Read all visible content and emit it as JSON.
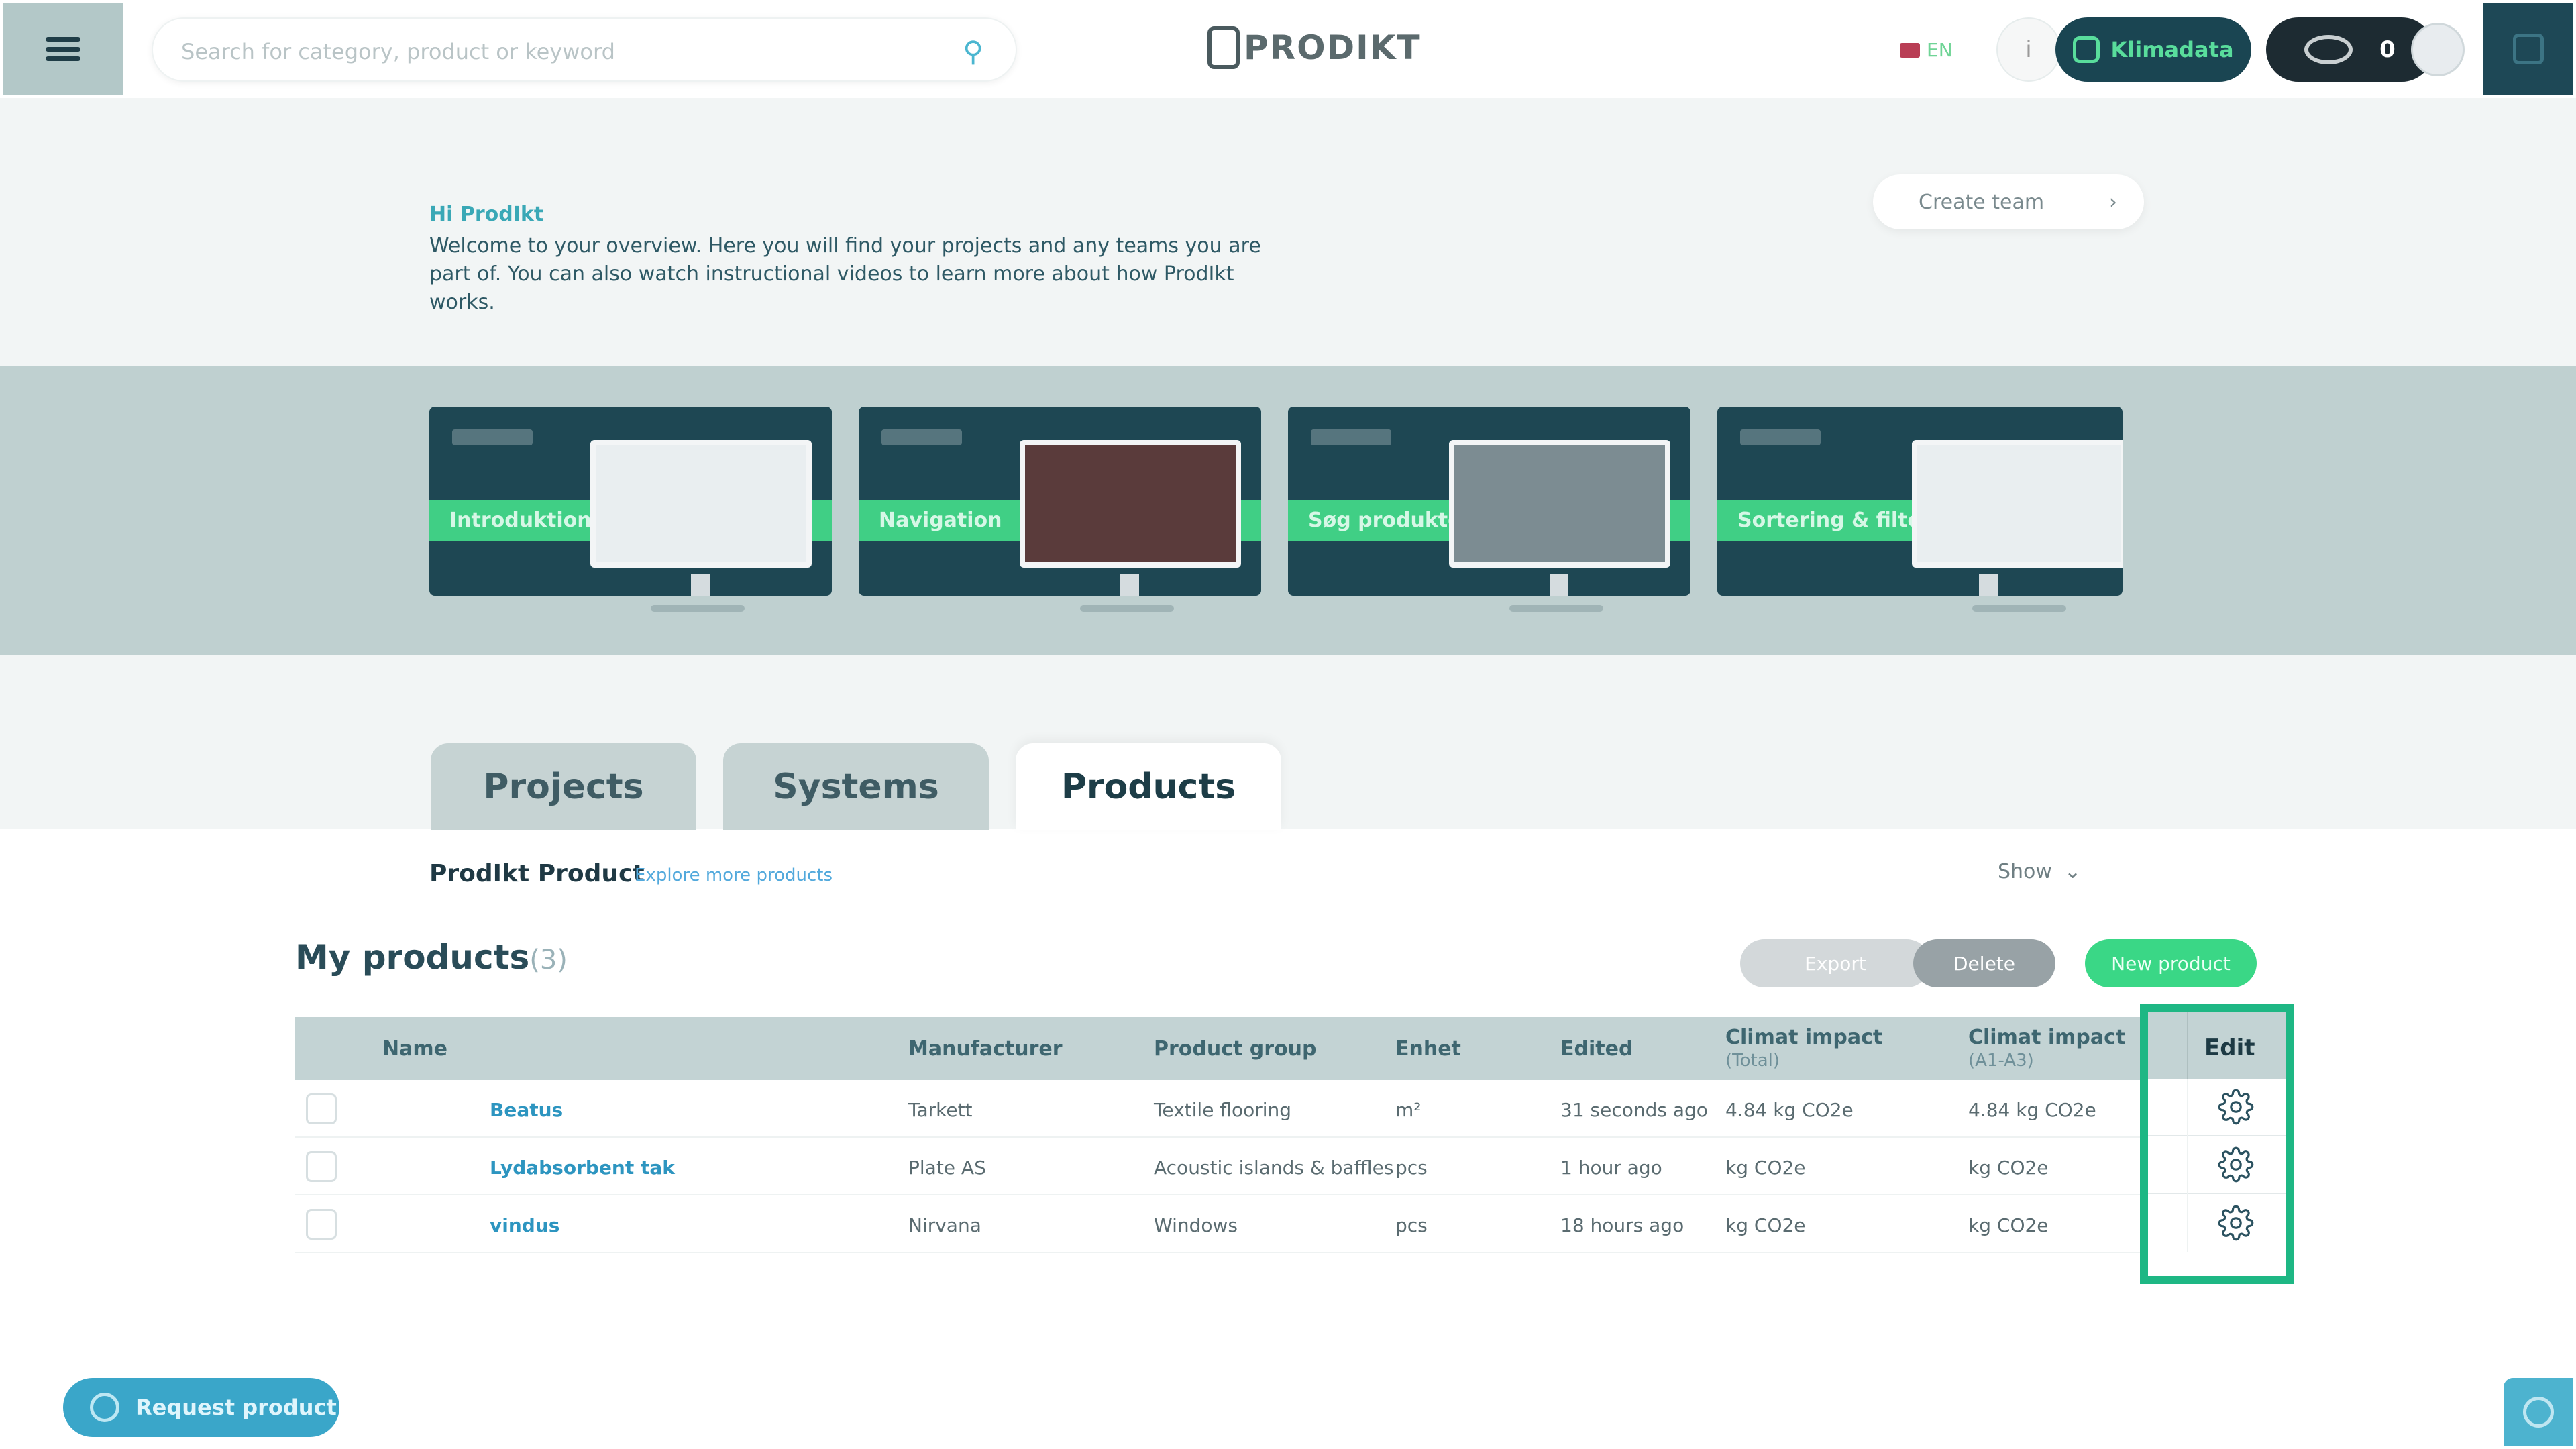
{
  "header": {
    "search_placeholder": "Search for category, product or keyword",
    "logo_text": "PRODIKT",
    "language": "EN",
    "climate_button": "Klimadata",
    "eye_count": "0"
  },
  "intro": {
    "greeting": "Hi ProdIkt",
    "text": "Welcome to your overview. Here you will find your projects and any teams you are part of. You can also watch instructional videos to learn more about how ProdIkt works.",
    "create_team": "Create team"
  },
  "videos": [
    {
      "label": "Introduktion"
    },
    {
      "label": "Navigation"
    },
    {
      "label": "Søg produkter"
    },
    {
      "label": "Sortering & filter"
    }
  ],
  "tabs": [
    {
      "label": "Projects",
      "active": false
    },
    {
      "label": "Systems",
      "active": false
    },
    {
      "label": "Products",
      "active": true
    }
  ],
  "products_section": {
    "heading": "ProdIkt Product",
    "explore_link": "Explore more products",
    "show_label": "Show",
    "my_products_title": "My products",
    "my_products_count": "(3)",
    "btn_grey1": "Export",
    "btn_grey2": "Delete",
    "btn_new": "New product"
  },
  "table": {
    "headers": {
      "name": "Name",
      "manufacturer": "Manufacturer",
      "product_group": "Product group",
      "unit": "Enhet",
      "edited": "Edited",
      "climate_total": "Climat impact",
      "climate_total_sub": "(Total)",
      "climate_a1a3": "Climat impact",
      "climate_a1a3_sub": "(A1-A3)",
      "edit": "Edit"
    },
    "rows": [
      {
        "name": "Beatus",
        "manufacturer": "Tarkett",
        "product_group": "Textile flooring",
        "unit": "m²",
        "edited": "31 seconds ago",
        "climate_total": "4.84 kg CO2e",
        "climate_a1a3": "4.84 kg CO2e"
      },
      {
        "name": "Lydabsorbent tak",
        "manufacturer": "Plate AS",
        "product_group": "Acoustic islands & baffles",
        "unit": "pcs",
        "edited": "1 hour ago",
        "climate_total": "kg CO2e",
        "climate_a1a3": "kg CO2e"
      },
      {
        "name": "vindus",
        "manufacturer": "Nirvana",
        "product_group": "Windows",
        "unit": "pcs",
        "edited": "18 hours ago",
        "climate_total": "kg CO2e",
        "climate_a1a3": "kg CO2e"
      }
    ]
  },
  "bottom": {
    "request_product": "Request product"
  },
  "colors": {
    "accent_green": "#1eb784",
    "dark_teal": "#1e4753",
    "header_row": "#c3d3d4"
  }
}
